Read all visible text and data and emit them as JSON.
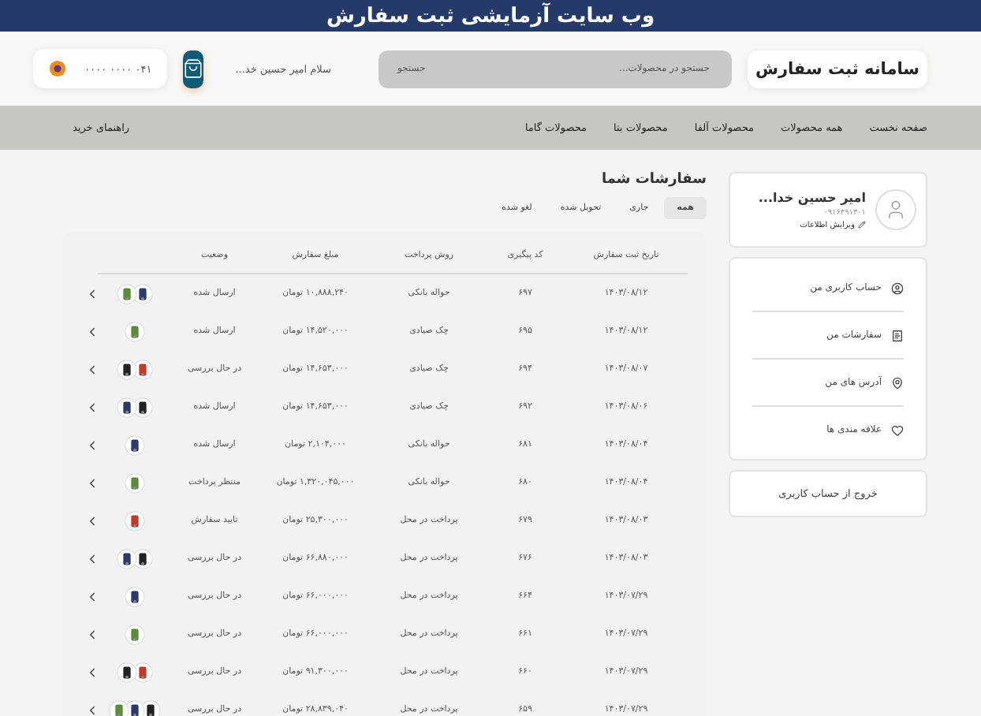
{
  "banner": {
    "title": "وب سایت آزمایشی ثبت سفارش"
  },
  "header": {
    "logo": "سامانه ثبت سفارش",
    "search": {
      "placeholder": "جستجو در محصولات...",
      "button": "جستجو"
    },
    "greeting": "سلام امیر حسین خد...",
    "phone": "۰۴۱ ۰۰۰۰ ۰۰۰۰"
  },
  "nav": {
    "items": [
      "صفحه نخست",
      "همه محصولات",
      "محصولات آلفا",
      "محصولات بتا",
      "محصولات گاما"
    ],
    "guide": "راهنمای خرید"
  },
  "profile": {
    "name": "امیر حسین خدا...",
    "phone": "۰۹۱۶۳۹۱۳۰۱",
    "edit": "ویرایش اطلاعات"
  },
  "menu": [
    {
      "kind": "account",
      "label": "حساب کاربری من"
    },
    {
      "kind": "orders",
      "label": "سفارشات من"
    },
    {
      "kind": "address",
      "label": "آدرس های من"
    },
    {
      "kind": "favorites",
      "label": "علاقه مندی ها"
    }
  ],
  "logout": "خروج از حساب کاربری",
  "orders": {
    "title": "سفارشات شما",
    "tabs": [
      {
        "label": "همه",
        "selected": true
      },
      {
        "label": "جاری",
        "selected": false
      },
      {
        "label": "تحویل شده",
        "selected": false
      },
      {
        "label": "لغو شده",
        "selected": false
      }
    ],
    "columns": [
      "تاریخ ثبت سفارش",
      "کد پیگیری",
      "روش پرداخت",
      "مبلغ سفارش",
      "وضعیت"
    ],
    "rows": [
      {
        "date": "۱۴۰۳/۰۸/۱۲",
        "code": "۶۹۷",
        "payment": "حواله بانکی",
        "amount": "۱۰,۸۸۸,۲۴۰ تومان",
        "status": "ارسال شده"
      },
      {
        "date": "۱۴۰۳/۰۸/۱۲",
        "code": "۶۹۵",
        "payment": "چک صیادی",
        "amount": "۱۴,۵۲۰,۰۰۰ تومان",
        "status": "ارسال شده"
      },
      {
        "date": "۱۴۰۳/۰۸/۰۷",
        "code": "۶۹۴",
        "payment": "چک صیادی",
        "amount": "۱۴,۶۵۳,۰۰۰ تومان",
        "status": "در حال بررسی"
      },
      {
        "date": "۱۴۰۳/۰۸/۰۶",
        "code": "۶۹۲",
        "payment": "چک صیادی",
        "amount": "۱۴,۶۵۳,۰۰۰ تومان",
        "status": "ارسال شده"
      },
      {
        "date": "۱۴۰۳/۰۸/۰۴",
        "code": "۶۸۱",
        "payment": "حواله بانکی",
        "amount": "۲,۱۰۴,۰۰۰ تومان",
        "status": "ارسال شده"
      },
      {
        "date": "۱۴۰۳/۰۸/۰۴",
        "code": "۶۸۰",
        "payment": "حواله بانکی",
        "amount": "۱,۳۲۰,۰۴۵,۰۰۰ تومان",
        "status": "منتظر پرداخت"
      },
      {
        "date": "۱۴۰۳/۰۸/۰۳",
        "code": "۶۷۹",
        "payment": "پرداخت در محل",
        "amount": "۲۵,۳۰۰,۰۰۰ تومان",
        "status": "تایید سفارش"
      },
      {
        "date": "۱۴۰۳/۰۸/۰۳",
        "code": "۶۷۶",
        "payment": "پرداخت در محل",
        "amount": "۶۶,۸۸۰,۰۰۰ تومان",
        "status": "در حال بررسی"
      },
      {
        "date": "۱۴۰۳/۰۷/۲۹",
        "code": "۶۶۴",
        "payment": "پرداخت در محل",
        "amount": "۶۶,۰۰۰,۰۰۰ تومان",
        "status": "در حال بررسی"
      },
      {
        "date": "۱۴۰۳/۰۷/۲۹",
        "code": "۶۶۱",
        "payment": "پرداخت در محل",
        "amount": "۶۶,۰۰۰,۰۰۰ تومان",
        "status": "در حال بررسی"
      },
      {
        "date": "۱۴۰۳/۰۷/۲۹",
        "code": "۶۶۰",
        "payment": "پرداخت در محل",
        "amount": "۹۱,۳۰۰,۰۰۰ تومان",
        "status": "در حال بررسی"
      },
      {
        "date": "۱۴۰۳/۰۷/۲۹",
        "code": "۶۵۹",
        "payment": "پرداخت در محل",
        "amount": "۲۸,۸۳۹,۰۴۰ تومان",
        "status": "در حال بررسی"
      }
    ]
  }
}
